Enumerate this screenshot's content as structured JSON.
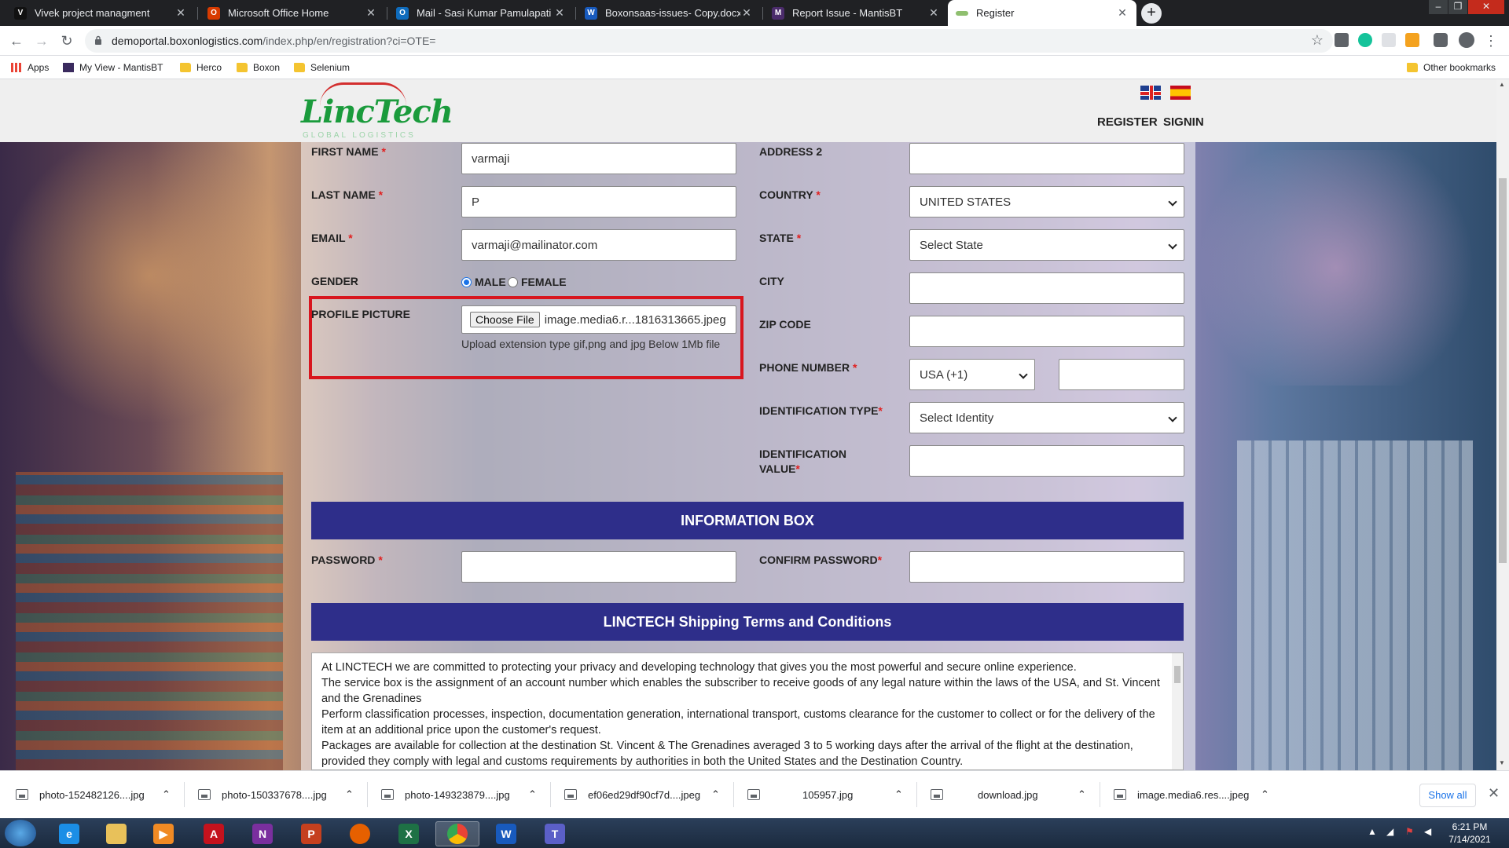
{
  "browser": {
    "tabs": [
      {
        "title": "Vivek project managment",
        "icon_color": "#111111",
        "icon_letter": "V"
      },
      {
        "title": "Microsoft Office Home",
        "icon_color": "#d83b01",
        "icon_letter": "O"
      },
      {
        "title": "Mail - Sasi Kumar Pamulapati - O",
        "icon_color": "#0f6cbd",
        "icon_letter": "O"
      },
      {
        "title": "Boxonsaas-issues- Copy.docx",
        "icon_color": "#185abd",
        "icon_letter": "W"
      },
      {
        "title": "Report Issue - MantisBT",
        "icon_color": "#4b2c6b",
        "icon_letter": "M"
      },
      {
        "title": "Register",
        "icon_color": "#8fbf6f",
        "icon_letter": ""
      }
    ],
    "url_host": "demoportal.boxonlogistics.com",
    "url_path": "/index.php/en/registration?ci=OTE=",
    "bookmarks": [
      {
        "label": "Apps",
        "icon": "apps-grid-icon"
      },
      {
        "label": "My View - MantisBT",
        "icon": "mantis-icon"
      },
      {
        "label": "Herco",
        "icon": "folder-icon"
      },
      {
        "label": "Boxon",
        "icon": "folder-icon"
      },
      {
        "label": "Selenium",
        "icon": "folder-icon"
      }
    ],
    "other_bookmarks": "Other bookmarks"
  },
  "site": {
    "logo_text": "LincTech",
    "logo_subtext": "GLOBAL LOGISTICS",
    "nav": {
      "register": "REGISTER",
      "signin": "SIGNIN"
    }
  },
  "form": {
    "first_name": {
      "label": "FIRST NAME",
      "value": "varmaji"
    },
    "last_name": {
      "label": "LAST NAME",
      "value": "P"
    },
    "email": {
      "label": "EMAIL",
      "value": "varmaji@mailinator.com"
    },
    "gender": {
      "label": "GENDER",
      "male": "MALE",
      "female": "FEMALE",
      "selected": "MALE"
    },
    "profile_picture": {
      "label": "PROFILE PICTURE",
      "button": "Choose File",
      "file_name": "image.media6.r...1816313665.jpeg",
      "hint": "Upload extension type gif,png and jpg Below 1Mb file"
    },
    "address2": {
      "label": "ADDRESS 2",
      "value": ""
    },
    "country": {
      "label": "COUNTRY",
      "value": "UNITED STATES"
    },
    "state": {
      "label": "STATE",
      "value": "Select State"
    },
    "city": {
      "label": "CITY",
      "value": ""
    },
    "zip": {
      "label": "ZIP CODE",
      "value": ""
    },
    "phone": {
      "label": "PHONE NUMBER",
      "code": "USA (+1)",
      "value": ""
    },
    "id_type": {
      "label": "IDENTIFICATION TYPE",
      "value": "Select Identity"
    },
    "id_value": {
      "label_line1": "IDENTIFICATION",
      "label_line2": "VALUE",
      "value": ""
    },
    "info_box_title": "INFORMATION BOX",
    "password": {
      "label": "PASSWORD",
      "value": ""
    },
    "confirm_password": {
      "label": "CONFIRM PASSWORD",
      "value": ""
    },
    "terms_title": "LINCTECH Shipping Terms and Conditions",
    "terms_paragraphs": [
      " At LINCTECH  we are committed to protecting your privacy and developing technology that gives you the most powerful and secure online experience.",
      "The service box is the assignment of an account number which enables the subscriber to receive goods of any legal nature within the laws of the USA, and St. Vincent and the Grenadines",
      "Perform classification processes, inspection, documentation generation, international transport, customs clearance for the customer to collect or for the delivery of the item at an additional price upon the customer's request.",
      "Packages are available for collection at the destination St. Vincent & The Grenadines averaged  3 to 5 working days after the arrival of the flight at the destination, provided they comply with legal and customs requirements by authorities in both the United States and the Destination Country."
    ]
  },
  "downloads": {
    "items": [
      "photo-152482126....jpg",
      "photo-150337678....jpg",
      "photo-149323879....jpg",
      "ef06ed29df90cf7d....jpeg",
      "105957.jpg",
      "download.jpg",
      "image.media6.res....jpeg"
    ],
    "show_all": "Show all"
  },
  "taskbar": {
    "time": "6:21 PM",
    "date": "7/14/2021"
  }
}
